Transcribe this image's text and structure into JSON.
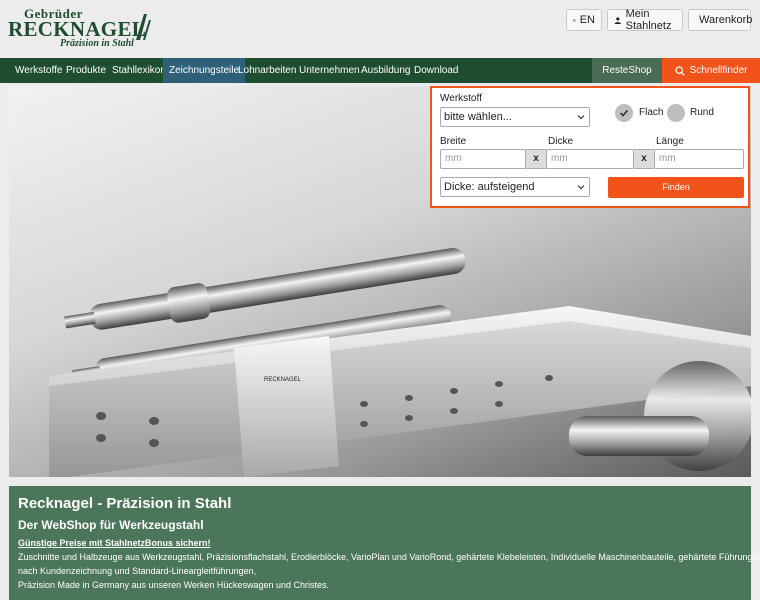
{
  "header": {
    "logo_small": "Gebrüder",
    "logo_big": "RECKNAGEL",
    "logo_tagline": "Präzision in Stahl",
    "lang_label": "EN",
    "account_label": "Mein Stahlnetz",
    "cart_label": "Warenkorb"
  },
  "nav": {
    "items": [
      "Werkstoffe",
      "Produkte",
      "Stahllexikon",
      "Zeichnungsteile",
      "Lohnarbeiten",
      "Unternehmen",
      "Ausbildung",
      "Download"
    ],
    "active_index": 3,
    "reste_label": "ResteShop",
    "finder_label": "Schnellfinder"
  },
  "finder": {
    "werkstoff_label": "Werkstoff",
    "werkstoff_value": "bitte wählen...",
    "flach_label": "Flach",
    "rund_label": "Rund",
    "selected_shape": "Flach",
    "breite_label": "Breite",
    "dicke_label": "Dicke",
    "laenge_label": "Länge",
    "placeholder": "mm",
    "x_sep": "x",
    "sort_value": "Dicke: aufsteigend",
    "find_label": "Finden"
  },
  "info": {
    "title": "Recknagel - Präzision in Stahl",
    "subtitle": "Der WebShop für Werkzeugstahl",
    "promo": "Günstige Preise mit StahlnetzBonus sichern!",
    "line1": "Zuschnitte und Halbzeuge aus Werkzeugstahl, Präzisionsflachstahl, Erodierblöcke, VarioPlan und VarioRond, gehärtete Klebeleisten, Individuelle Maschinenbauteile, gehärtete Führungsleisten",
    "line2": "nach Kundenzeichnung und Standard-Lineargleitführungen,",
    "line3": "Präzision Made in Germany aus unseren Werken Hückeswagen und Christes."
  },
  "hero": {
    "engraving": "RECKNAGEL"
  },
  "colors": {
    "brand_green": "#1e4d2f",
    "accent_orange": "#f1531b",
    "active_blue": "#2e6079",
    "info_green": "#4b7659"
  }
}
